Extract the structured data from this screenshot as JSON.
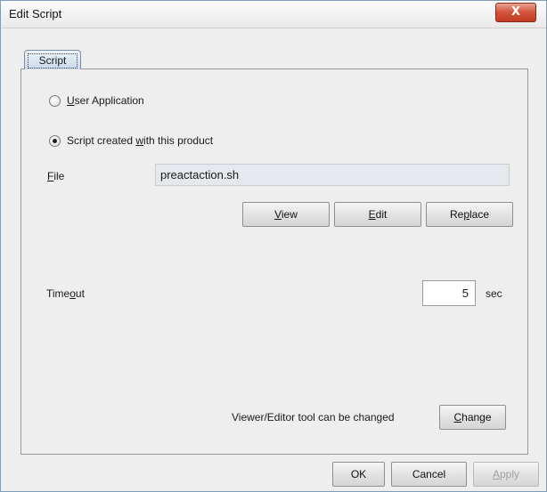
{
  "window": {
    "title": "Edit Script",
    "close_glyph": "X"
  },
  "tabs": [
    {
      "label": "Script",
      "active": true
    }
  ],
  "script_source": {
    "options": [
      {
        "prefix": "",
        "mnemonic": "U",
        "suffix": "ser Application",
        "selected": false
      },
      {
        "prefix": "Script created ",
        "mnemonic": "w",
        "suffix": "ith this product",
        "selected": true
      }
    ]
  },
  "file": {
    "label_mnemonic": "F",
    "label_rest": "ile",
    "value": "preactaction.sh"
  },
  "file_buttons": {
    "view": {
      "mnemonic": "V",
      "rest": "iew"
    },
    "edit": {
      "mnemonic": "E",
      "rest": "dit"
    },
    "replace": {
      "prefix": "Re",
      "mnemonic": "p",
      "rest": "lace"
    }
  },
  "timeout": {
    "label_prefix": "Time",
    "label_mnemonic": "o",
    "label_rest": "ut",
    "value": "5",
    "unit": "sec"
  },
  "tool": {
    "text": "Viewer/Editor tool can be changed",
    "change_mnemonic": "C",
    "change_rest": "hange"
  },
  "footer": {
    "ok": "OK",
    "cancel": "Cancel",
    "apply_mnemonic": "A",
    "apply_rest": "pply",
    "apply_enabled": false
  },
  "colors": {
    "close_button": "#d1523a",
    "tab_fill": "#c8d9ec",
    "panel_bg": "#eeeeee"
  }
}
